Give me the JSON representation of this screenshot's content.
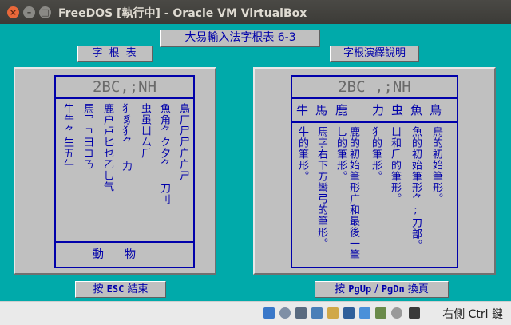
{
  "window": {
    "title": "FreeDOS [執行中] - Oracle VM VirtualBox",
    "close_glyph": "×",
    "min_glyph": "–",
    "max_glyph": "□"
  },
  "app": {
    "main_title": "大易輸入法字根表 6-3",
    "tab_roots": "字 根 表",
    "tab_explain": "字根演繹說明",
    "left_panel": {
      "header": "2BC,;NH",
      "columns": [
        "牛⺧⺈生五午",
        "馬乛ㄱ彐ヨㄋ",
        "鹿户卢匕乜乙乚气",
        "犭豸⺨⺈ 力",
        "虫虽ㄩ厶⺁",
        "魚角⺈ク夕⺈ 刀刂",
        "鳥厂尸尸户户ㄕ"
      ],
      "footer": "動物"
    },
    "right_panel": {
      "header": "2BC ,;NH",
      "row_labels": [
        "牛",
        "馬",
        "鹿",
        "力",
        "虫",
        "魚",
        "鳥"
      ],
      "columns": [
        "牛的筆形。",
        "馬字右下方彎弓的筆形。",
        "鹿的初始筆形广和最後一筆乚的筆形。",
        "犭的筆形。",
        "ㄩ和⺁的筆形。",
        "魚的初始筆形⺈;刀部。",
        "鳥的初始筆形。"
      ]
    },
    "btn_esc": {
      "pre": "按",
      "key": "ESC",
      "post": "結束"
    },
    "btn_page": {
      "pre": "按",
      "key1": "PgUp",
      "sep": "/",
      "key2": "PgDn",
      "post": "換頁"
    }
  },
  "statusbar": {
    "host_key": "右側 Ctrl 鍵",
    "icons": [
      "optical-drive-icon",
      "audio-icon",
      "usb-icon",
      "network-icon",
      "shared-folder-icon",
      "display-icon",
      "video-capture-icon",
      "cpu-icon",
      "mouse-integration-icon",
      "host-key-arrow-icon"
    ]
  }
}
